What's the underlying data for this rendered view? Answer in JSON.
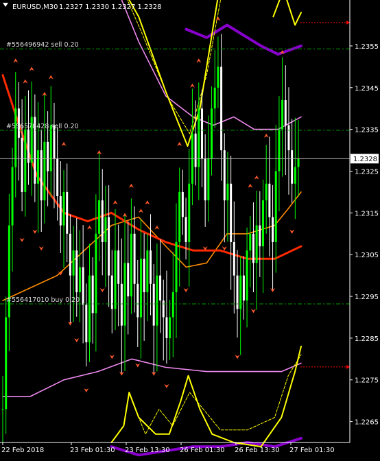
{
  "header": {
    "symbol_tf": "EURUSD,M30",
    "quote": "1.2327 1.2330 1.2327 1.2328"
  },
  "orders": [
    {
      "label": "#556496942 sell 0.20",
      "price": 1.23543
    },
    {
      "label": "#556578428 sell 0.20",
      "price": 1.23348
    },
    {
      "label": "#556417010 buy 0.20",
      "price": 1.22932
    }
  ],
  "chart_data": {
    "type": "candlestick",
    "symbol": "EURUSD",
    "timeframe": "M30",
    "ylim": [
      1.226,
      1.2366
    ],
    "y_ticks": [
      1.2355,
      1.2345,
      1.2335,
      1.2325,
      1.2315,
      1.2305,
      1.2295,
      1.2285,
      1.2275,
      1.2265
    ],
    "x_ticks": [
      "22 Feb 2018",
      "23 Feb 01:30",
      "23 Feb 13:30",
      "26 Feb 01:30",
      "26 Feb 13:30",
      "27 Feb 01:30"
    ],
    "current_price": 1.2328,
    "bid_price_label": "1.2328",
    "upper_marker_price": 1.23606,
    "lower_marker_price": 1.22781,
    "colors": {
      "background": "#000000",
      "bull": "#00ff00",
      "bear": "#ffffff",
      "ma_slow": "#ff2a00",
      "ma_mid": "#ff8c00",
      "band": "#ee88ee",
      "envelope": "#ffff00",
      "envelope_edge": "#8800cc",
      "arrows": "#ff5a2a",
      "order_line": "#00a000"
    },
    "closes": [
      1.2268,
      1.229,
      1.2312,
      1.2326,
      1.234,
      1.2333,
      1.232,
      1.2335,
      1.2327,
      1.2338,
      1.2322,
      1.233,
      1.2318,
      1.2332,
      1.2325,
      1.2336,
      1.2328,
      1.2319,
      1.2312,
      1.232,
      1.231,
      1.23,
      1.2306,
      1.2296,
      1.2302,
      1.2293,
      1.2284,
      1.23,
      1.2291,
      1.231,
      1.2318,
      1.2308,
      1.2314,
      1.23,
      1.2292,
      1.2306,
      1.2298,
      1.2288,
      1.2303,
      1.2295,
      1.231,
      1.2298,
      1.229,
      1.2304,
      1.2296,
      1.2306,
      1.2298,
      1.2288,
      1.23,
      1.2294,
      1.229,
      1.2285,
      1.229,
      1.2296,
      1.2308,
      1.232,
      1.2314,
      1.2308,
      1.2322,
      1.2334,
      1.2326,
      1.234,
      1.2328,
      1.2318,
      1.2328,
      1.234,
      1.2345,
      1.235,
      1.233,
      1.2318,
      1.2322,
      1.2308,
      1.23,
      1.2292,
      1.23,
      1.2294,
      1.2306,
      1.231,
      1.2303,
      1.2312,
      1.2307,
      1.2318,
      1.2322,
      1.2314,
      1.2308,
      1.2325,
      1.2335,
      1.2342,
      1.2336,
      1.233,
      1.2322,
      1.2326,
      1.2328
    ],
    "ma_slow": [
      [
        0,
        1.2348
      ],
      [
        20,
        1.2338
      ],
      [
        50,
        1.2324
      ],
      [
        90,
        1.2315
      ],
      [
        125,
        1.2313
      ],
      [
        160,
        1.2315
      ],
      [
        200,
        1.2311
      ],
      [
        240,
        1.2308
      ],
      [
        280,
        1.2306
      ],
      [
        320,
        1.2306
      ],
      [
        360,
        1.2304
      ],
      [
        400,
        1.2304
      ],
      [
        439,
        1.2307
      ]
    ],
    "ma_mid": [
      [
        0,
        1.2294
      ],
      [
        40,
        1.2297
      ],
      [
        80,
        1.23
      ],
      [
        120,
        1.2306
      ],
      [
        160,
        1.2312
      ],
      [
        200,
        1.2314
      ],
      [
        240,
        1.2307
      ],
      [
        270,
        1.2302
      ],
      [
        300,
        1.2303
      ],
      [
        330,
        1.231
      ],
      [
        360,
        1.231
      ],
      [
        400,
        1.2312
      ],
      [
        420,
        1.2316
      ],
      [
        439,
        1.232
      ]
    ],
    "band_upper": [
      [
        165,
        1.237
      ],
      [
        200,
        1.2356
      ],
      [
        240,
        1.2343
      ],
      [
        280,
        1.2338
      ],
      [
        310,
        1.2336
      ],
      [
        340,
        1.2338
      ],
      [
        370,
        1.2335
      ],
      [
        405,
        1.2335
      ],
      [
        439,
        1.2338
      ]
    ],
    "band_lower": [
      [
        0,
        1.2271
      ],
      [
        40,
        1.2271
      ],
      [
        90,
        1.2275
      ],
      [
        140,
        1.2277
      ],
      [
        190,
        1.228
      ],
      [
        240,
        1.2278
      ],
      [
        300,
        1.2277
      ],
      [
        360,
        1.2277
      ],
      [
        410,
        1.2277
      ],
      [
        439,
        1.2279
      ]
    ],
    "envelope_top_main": [
      [
        165,
        1.2372
      ],
      [
        200,
        1.2362
      ],
      [
        240,
        1.2344
      ],
      [
        272,
        1.2331
      ],
      [
        290,
        1.234
      ],
      [
        318,
        1.2368
      ]
    ],
    "envelope_top_inner": [
      [
        170,
        1.2371
      ],
      [
        205,
        1.2358
      ],
      [
        245,
        1.2342
      ],
      [
        275,
        1.2334
      ],
      [
        300,
        1.2348
      ],
      [
        325,
        1.237
      ]
    ],
    "envelope_top_outer": [
      [
        270,
        1.2359
      ],
      [
        300,
        1.2357
      ],
      [
        330,
        1.236
      ],
      [
        350,
        1.2358
      ],
      [
        380,
        1.2355
      ],
      [
        405,
        1.2353
      ],
      [
        439,
        1.2355
      ]
    ],
    "envelope_top_right": [
      [
        398,
        1.2362
      ],
      [
        412,
        1.2368
      ],
      [
        418,
        1.2366
      ],
      [
        430,
        1.236
      ],
      [
        439,
        1.2363
      ]
    ],
    "envelope_bottom_main": [
      [
        160,
        1.226
      ],
      [
        178,
        1.2264
      ],
      [
        186,
        1.2272
      ],
      [
        200,
        1.2266
      ],
      [
        225,
        1.2262
      ],
      [
        245,
        1.2262
      ],
      [
        262,
        1.227
      ],
      [
        273,
        1.2276
      ],
      [
        290,
        1.2268
      ],
      [
        308,
        1.2262
      ],
      [
        340,
        1.226
      ],
      [
        380,
        1.2259
      ],
      [
        410,
        1.2266
      ],
      [
        430,
        1.2277
      ],
      [
        439,
        1.2283
      ]
    ],
    "envelope_bottom_inner": [
      [
        190,
        1.227
      ],
      [
        210,
        1.2262
      ],
      [
        230,
        1.2268
      ],
      [
        250,
        1.2264
      ],
      [
        275,
        1.2272
      ],
      [
        300,
        1.2267
      ],
      [
        320,
        1.2263
      ],
      [
        360,
        1.2263
      ],
      [
        400,
        1.2266
      ],
      [
        420,
        1.2276
      ],
      [
        439,
        1.2281
      ]
    ],
    "envelope_bottom_outer": [
      [
        160,
        1.2259
      ],
      [
        200,
        1.2257
      ],
      [
        240,
        1.2258
      ],
      [
        280,
        1.2259
      ],
      [
        320,
        1.2259
      ],
      [
        360,
        1.226
      ],
      [
        400,
        1.2259
      ],
      [
        439,
        1.2261
      ]
    ]
  }
}
